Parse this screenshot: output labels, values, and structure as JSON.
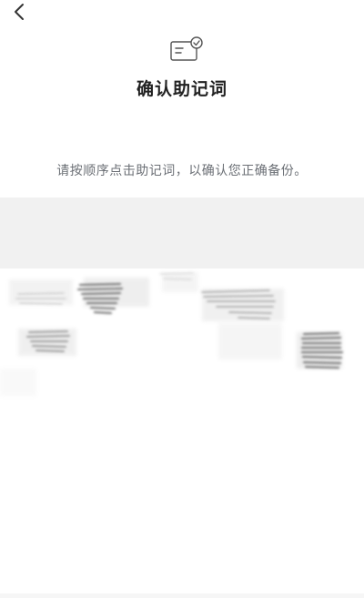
{
  "header": {
    "back_icon": "chevron-left-icon",
    "illustration_icon": "mnemonic-card-check-icon",
    "title": "确认助记词"
  },
  "instruction": "请按顺序点击助记词，以确认您正确备份。",
  "selected_area": {
    "words": []
  },
  "word_pool": {
    "note": "",
    "words": [
      "",
      "",
      "",
      "",
      "",
      "",
      "",
      ""
    ]
  },
  "colors": {
    "title": "#222222",
    "instruction": "#6b6f75",
    "selected_area_bg": "#f1f1f1",
    "scribble": "#5a5a5a"
  }
}
